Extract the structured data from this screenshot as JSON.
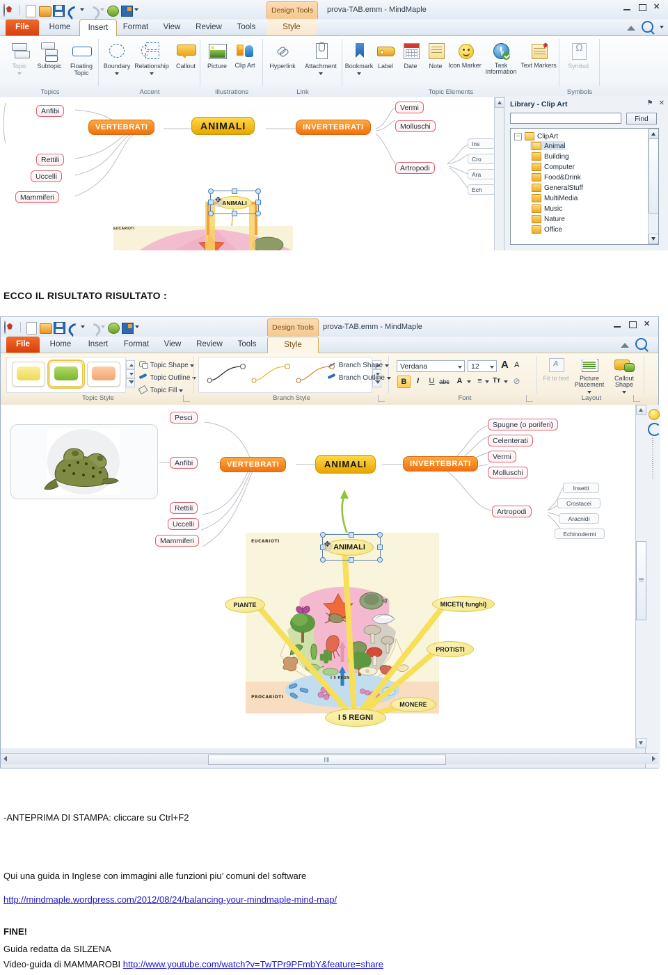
{
  "window": {
    "title": "prova-TAB.emm - MindMaple",
    "contextual_tab": "Design Tools",
    "min_label": "–",
    "max_label": "❐",
    "close_label": "✕"
  },
  "quick_access": {
    "items": [
      "mindmaple-orb",
      "new-icon",
      "open-icon",
      "save-icon",
      "undo-icon",
      "undo-dropdown",
      "redo-icon",
      "redo-dropdown",
      "new-map-icon",
      "export-icon",
      "customize-dropdown"
    ]
  },
  "tabs": {
    "items": [
      "File",
      "Home",
      "Insert",
      "Format",
      "View",
      "Review",
      "Tools",
      "Style"
    ],
    "active_screenshot_one": "Insert",
    "active_screenshot_two": "Style"
  },
  "ribbon_insert": {
    "groups": [
      {
        "label": "Topics",
        "buttons": [
          {
            "label": "Topic",
            "icon": "topic-icon",
            "dropdown": true,
            "disabled": true
          },
          {
            "label": "Subtopic",
            "icon": "subtopic-icon",
            "dropdown": false,
            "disabled": false
          },
          {
            "label": "Floating Topic",
            "icon": "floating-topic-icon",
            "dropdown": false,
            "disabled": false
          }
        ]
      },
      {
        "label": "Accent",
        "buttons": [
          {
            "label": "Boundary",
            "icon": "boundary-icon",
            "dropdown": true,
            "disabled": false
          },
          {
            "label": "Relationship",
            "icon": "relationship-icon",
            "dropdown": true,
            "disabled": false
          },
          {
            "label": "Callout",
            "icon": "callout-icon",
            "dropdown": false,
            "disabled": false
          }
        ]
      },
      {
        "label": "Illustrations",
        "buttons": [
          {
            "label": "Picture",
            "icon": "picture-icon",
            "dropdown": false,
            "disabled": false
          },
          {
            "label": "Clip Art",
            "icon": "clip-art-icon",
            "dropdown": false,
            "disabled": false
          }
        ]
      },
      {
        "label": "Link",
        "buttons": [
          {
            "label": "Hyperlink",
            "icon": "hyperlink-icon",
            "dropdown": false,
            "disabled": false
          },
          {
            "label": "Attachment",
            "icon": "attachment-icon",
            "dropdown": true,
            "disabled": false
          }
        ]
      },
      {
        "label": "Topic Elements",
        "buttons": [
          {
            "label": "Bookmark",
            "icon": "bookmark-icon",
            "dropdown": true,
            "disabled": false
          },
          {
            "label": "Label",
            "icon": "label-icon",
            "dropdown": false,
            "disabled": false
          },
          {
            "label": "Date",
            "icon": "date-icon",
            "dropdown": false,
            "disabled": false
          },
          {
            "label": "Note",
            "icon": "note-icon",
            "dropdown": false,
            "disabled": false
          },
          {
            "label": "Icon Marker",
            "icon": "icon-marker-icon",
            "dropdown": true,
            "disabled": false
          },
          {
            "label": "Task Information",
            "icon": "task-information-icon",
            "dropdown": false,
            "disabled": false
          },
          {
            "label": "Text Markers",
            "icon": "text-markers-icon",
            "dropdown": true,
            "disabled": false
          }
        ]
      },
      {
        "label": "Symbols",
        "buttons": [
          {
            "label": "Symbol",
            "icon": "symbol-icon",
            "dropdown": false,
            "disabled": true
          }
        ]
      }
    ]
  },
  "ribbon_style": {
    "groups": [
      {
        "label": "Topic Style",
        "swatches": [
          {
            "name": "yellow-topic-style",
            "color": "#f5e06a",
            "selected": false
          },
          {
            "name": "green-topic-style",
            "color": "#8cc63f",
            "selected": true
          },
          {
            "name": "orange-topic-style",
            "color": "#f6b183",
            "selected": false
          }
        ],
        "menus": [
          {
            "label": "Topic Shape",
            "icon": "topic-shape-icon"
          },
          {
            "label": "Topic Outline",
            "icon": "topic-outline-icon"
          },
          {
            "label": "Topic Fill",
            "icon": "topic-fill-icon"
          }
        ]
      },
      {
        "label": "Branch Style",
        "thumbs": [
          "branch-style-black",
          "branch-style-yellow",
          "branch-style-orange"
        ],
        "menus": [
          {
            "label": "Branch Shape",
            "icon": "branch-shape-icon"
          },
          {
            "label": "Branch Outline",
            "icon": "branch-outline-icon"
          }
        ]
      },
      {
        "label": "Font",
        "font_family": "Verdana",
        "font_size": "12",
        "grow_label": "A",
        "shrink_label": "A",
        "buttons": [
          {
            "name": "bold",
            "label": "B",
            "active": true
          },
          {
            "name": "italic",
            "label": "I",
            "active": false
          },
          {
            "name": "underline",
            "label": "U",
            "active": false
          },
          {
            "name": "strikethrough",
            "label": "abc",
            "active": false
          },
          {
            "name": "font-color",
            "label": "A",
            "active": false
          },
          {
            "name": "align",
            "label": "≡",
            "active": false
          },
          {
            "name": "text-direction",
            "label": "Tт",
            "active": false
          },
          {
            "name": "clear-formatting",
            "label": "⊘",
            "active": false
          }
        ]
      },
      {
        "label": "Layout",
        "buttons": [
          {
            "label": "Fit to text",
            "icon": "fit-to-text-icon",
            "disabled": true,
            "dropdown": false
          },
          {
            "label": "Picture Placement",
            "icon": "picture-placement-icon",
            "disabled": false,
            "dropdown": true
          },
          {
            "label": "Callout Shape",
            "icon": "callout-shape-icon",
            "disabled": false,
            "dropdown": true
          }
        ]
      }
    ]
  },
  "library_panel": {
    "title": "Library - Clip Art",
    "pin_label": "⚑",
    "close_label": "✕",
    "search_value": "",
    "find_label": "Find",
    "root": "ClipArt",
    "folders": [
      "Animal",
      "Building",
      "Computer",
      "Food&Drink",
      "GeneralStuff",
      "MultiMedia",
      "Music",
      "Nature",
      "Office"
    ],
    "selected_folder": "Animal"
  },
  "map_one": {
    "center": "ANIMALI",
    "left_branch": "VERTEBRATI",
    "right_branch": "INVERTEBRATI",
    "vertebrati_children": [
      "Anfibi",
      "Rettili",
      "Uccelli",
      "Mammiferi"
    ],
    "invertebrati_children": [
      "Vermi",
      "Molluschi",
      "Artropodi"
    ],
    "artropodi_children": [
      "Ins",
      "Cro",
      "Ara",
      "Ech"
    ],
    "callout": "ANIMALI",
    "image_label": "EUCARIOTI"
  },
  "map_two": {
    "center": "ANIMALI",
    "left_branch": "VERTEBRATI",
    "right_branch": "INVERTEBRATI",
    "vertebrati_children": [
      "Pesci",
      "Anfibi",
      "Rettili",
      "Uccelli",
      "Mammiferi"
    ],
    "invertebrati_children": [
      "Spugne (o poriferi)",
      "Celenterati",
      "Vermi",
      "Molluschi",
      "Artropodi"
    ],
    "artropodi_children": [
      "Insetti",
      "Crostacei",
      "Aracnidi",
      "Echinodermi"
    ],
    "callout": "ANIMALI",
    "picture_node": "frog-photo",
    "kingdoms_diagram": {
      "title": "I 5 REGNI",
      "zone_top": "EUCARIOTI",
      "zone_bottom": "PROCARIOTI",
      "center_label": "I 5 REGNI",
      "labels": [
        "ANIMALI",
        "PIANTE",
        "MICETI( funghi)",
        "PROTISTI",
        "MONERE"
      ]
    }
  },
  "page": {
    "heading": "ECCO IL RISULTATO RISULTATO :",
    "print_preview_bold": "-ANTEPRIMA DI STAMPA:",
    "print_preview_rest": " cliccare su Ctrl+F2",
    "guide_line": "Qui una guida in Inglese  con immagini alle funzioni  piu’ comuni  del software",
    "guide_link": "http://mindmaple.wordpress.com/2012/08/24/balancing-your-mindmaple-mind-map/",
    "end_label": "FINE!",
    "author_line": "Guida redatta da SILZENA",
    "video_prefix": "Video-guida di MAMMAROBI ",
    "video_link": "http://www.youtube.com/watch?v=TwTPr9PFmbY&feature=share"
  }
}
